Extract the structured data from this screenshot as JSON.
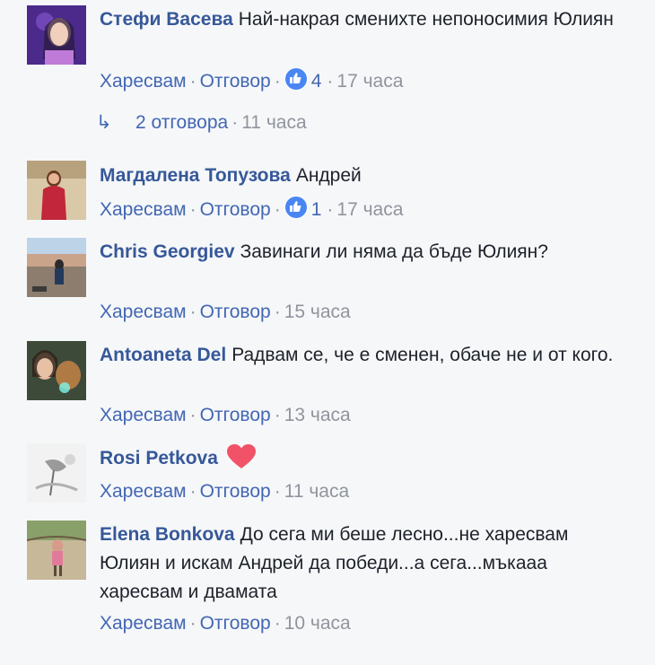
{
  "actions": {
    "like_label": "Харесвам",
    "reply_label": "Отговор"
  },
  "comments": [
    {
      "author": "Стефи Васева",
      "text": "Най-накрая сменихте непоносимия Юлиян",
      "likes": "4",
      "time": "17 часа",
      "replies": {
        "label": "2 отговора",
        "time": "11 часа"
      }
    },
    {
      "author": "Магдалена Топузова",
      "text": "Андрей",
      "likes": "1",
      "time": "17 часа"
    },
    {
      "author": "Chris Georgiev",
      "text": "Завинаги ли няма да бъде Юлиян?",
      "time": "15 часа"
    },
    {
      "author": "Antoaneta Del",
      "text": "Радвам се, че е сменен, обаче не и от кого.",
      "time": "13 часа"
    },
    {
      "author": "Rosi Petkova",
      "text": "",
      "reaction": "heart-icon",
      "time": "11 часа"
    },
    {
      "author": "Elena Bonkova",
      "text": "До сега ми беше лесно...не харесвам Юлиян и искам Андрей да победи...а сега...мъкааа харесвам и двамата",
      "time": "10 часа"
    }
  ],
  "colors": {
    "author": "#365899",
    "link": "#4267b2",
    "meta": "#90949c",
    "like_badge": "#4a86f2",
    "heart": "#f25268",
    "background": "#f6f7f9"
  }
}
